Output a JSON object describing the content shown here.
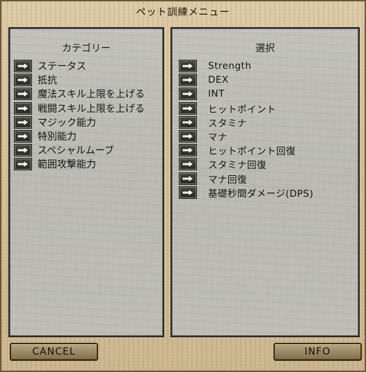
{
  "window": {
    "title": "ペット訓練メニュー"
  },
  "category_panel": {
    "header": "カテゴリー",
    "items": [
      {
        "label": "ステータス"
      },
      {
        "label": "抵抗"
      },
      {
        "label": "魔法スキル上限を上げる"
      },
      {
        "label": "戦闘スキル上限を上げる"
      },
      {
        "label": "マジック能力"
      },
      {
        "label": "特別能力"
      },
      {
        "label": "スペシャルムーブ"
      },
      {
        "label": "範囲攻撃能力"
      }
    ]
  },
  "selection_panel": {
    "header": "選択",
    "items": [
      {
        "label": "Strength"
      },
      {
        "label": "DEX"
      },
      {
        "label": "INT"
      },
      {
        "label": "ヒットポイント"
      },
      {
        "label": "スタミナ"
      },
      {
        "label": "マナ"
      },
      {
        "label": "ヒットポイント回復"
      },
      {
        "label": "スタミナ回復"
      },
      {
        "label": "マナ回復"
      },
      {
        "label": "基礎秒間ダメージ(DPS)"
      }
    ]
  },
  "buttons": {
    "cancel": "CANCEL",
    "info": "INFO"
  },
  "icons": {
    "item_button": "arrow-right-icon"
  }
}
